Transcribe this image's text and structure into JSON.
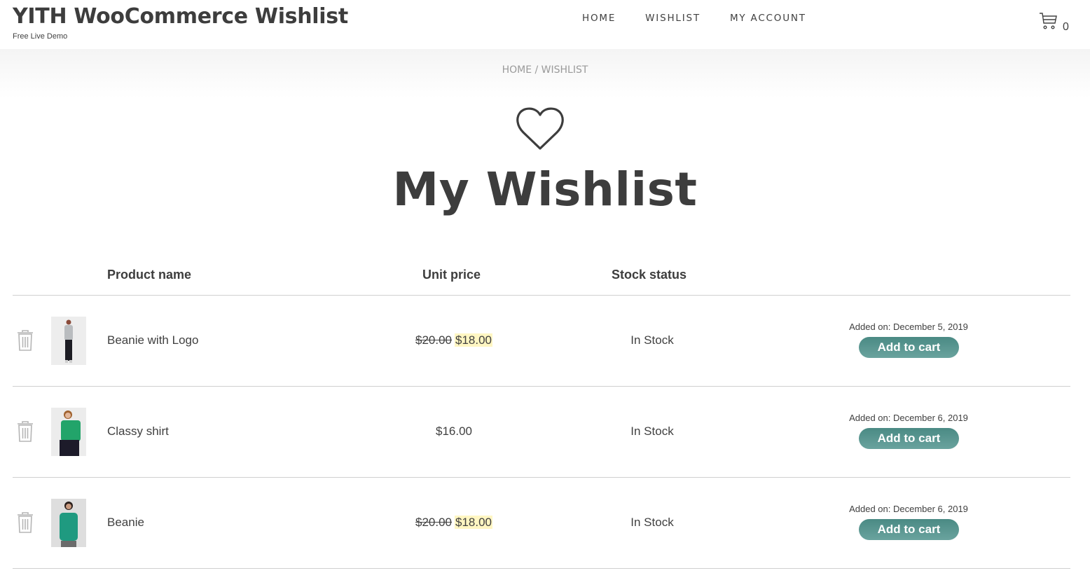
{
  "header": {
    "site_title": "YITH WooCommerce Wishlist",
    "tagline": "Free Live Demo",
    "nav": [
      "HOME",
      "WISHLIST",
      "MY ACCOUNT"
    ],
    "cart_count": "0"
  },
  "breadcrumb": "HOME / WISHLIST",
  "page_title": "My Wishlist",
  "table": {
    "columns": [
      "Product name",
      "Unit price",
      "Stock status"
    ],
    "add_to_cart_label": "Add to cart",
    "rows": [
      {
        "name": "Beanie with Logo",
        "regular_price": "$20.00",
        "sale_price": "$18.00",
        "stock": "In Stock",
        "added": "Added on: December 5, 2019",
        "thumb_colors": {
          "top": "#b9bcbf",
          "bottom": "#1d1d24",
          "bg": "#ededed"
        }
      },
      {
        "name": "Classy shirt",
        "regular_price": "",
        "sale_price": "",
        "price": "$16.00",
        "stock": "In Stock",
        "added": "Added on: December 6, 2019",
        "thumb_colors": {
          "top": "#22a46a",
          "bottom": "#1d1b2a",
          "bg": "#ececec"
        }
      },
      {
        "name": "Beanie",
        "regular_price": "$20.00",
        "sale_price": "$18.00",
        "stock": "In Stock",
        "added": "Added on: December 6, 2019",
        "thumb_colors": {
          "top": "#1f9a80",
          "bottom": "#6b6b6b",
          "bg": "#dedede"
        }
      }
    ]
  },
  "colors": {
    "accent_button": "#4f8f89",
    "sale_highlight": "#fff6c2"
  }
}
